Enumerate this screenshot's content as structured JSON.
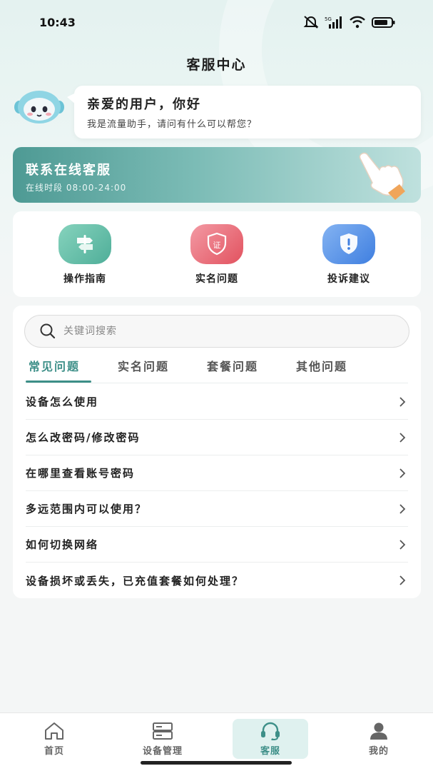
{
  "status_bar": {
    "time": "10:43",
    "network": "5G"
  },
  "header": {
    "title": "客服中心"
  },
  "greeting": {
    "title": "亲爱的用户，你好",
    "subtitle": "我是流量助手，请问有什么可以帮您？"
  },
  "banner": {
    "title": "联系在线客服",
    "subtitle": "在线时段 08:00-24:00"
  },
  "quick_actions": [
    {
      "label": "操作指南",
      "icon": "signpost-icon",
      "color": "#5fb8a3"
    },
    {
      "label": "实名问题",
      "icon": "shield-id-icon",
      "color": "#e9606f",
      "badge": "证"
    },
    {
      "label": "投诉建议",
      "icon": "shield-alert-icon",
      "color": "#4f8fe6"
    }
  ],
  "search": {
    "placeholder": "关键词搜索"
  },
  "tabs": [
    {
      "label": "常见问题",
      "active": true
    },
    {
      "label": "实名问题",
      "active": false
    },
    {
      "label": "套餐问题",
      "active": false
    },
    {
      "label": "其他问题",
      "active": false
    }
  ],
  "faq": [
    "设备怎么使用",
    "怎么改密码/修改密码",
    "在哪里查看账号密码",
    "多远范围内可以使用？",
    "如何切换网络",
    "设备损坏或丢失，已充值套餐如何处理？"
  ],
  "bottom_nav": [
    {
      "label": "首页",
      "icon": "home-icon",
      "active": false
    },
    {
      "label": "设备管理",
      "icon": "device-icon",
      "active": false
    },
    {
      "label": "客服",
      "icon": "headset-icon",
      "active": true
    },
    {
      "label": "我的",
      "icon": "user-icon",
      "active": false
    }
  ],
  "colors": {
    "accent": "#3d8f88",
    "banner_start": "#4e9a94",
    "banner_end": "#bfe1de"
  }
}
